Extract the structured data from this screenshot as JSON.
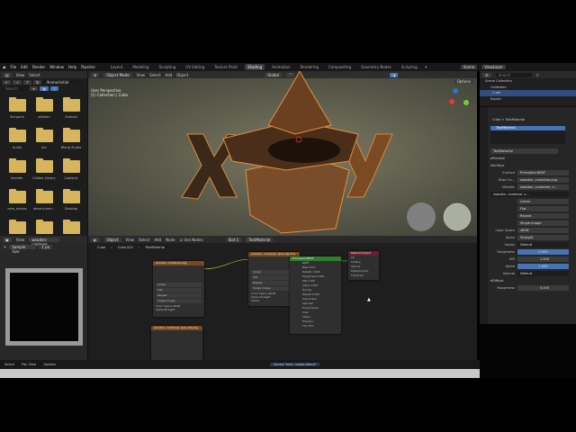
{
  "menu": [
    "File",
    "Edit",
    "Render",
    "Window",
    "Help",
    "Pipeline"
  ],
  "workspaces": [
    "Layout",
    "Modeling",
    "Sculpting",
    "UV Editing",
    "Texture Paint",
    "Shading",
    "Animation",
    "Rendering",
    "Compositing",
    "Geometry Nodes",
    "Scripting"
  ],
  "active_workspace": "Shading",
  "scene": "Scene",
  "view_layer": "ViewLayer",
  "files": {
    "header": [
      "View",
      "Select"
    ],
    "path": "/home/initial",
    "search_placeholder": "Search",
    "items": [
      "3rd-party",
      "ableton",
      "Android",
      "Audio",
      "bin",
      "Bforig Studio",
      "blender",
      "Calibre Library",
      "Coatsink",
      "core_dumps",
      "decent-sam...",
      "Desktop",
      "",
      "",
      ""
    ]
  },
  "viewport": {
    "mode": "Object Mode",
    "menus": [
      "View",
      "Select",
      "Add",
      "Object"
    ],
    "overlay1": "User Perspective",
    "overlay2": "(1) Collection | Cube",
    "transform": "Global",
    "options": "Options"
  },
  "outliner": {
    "search_placeholder": "Search",
    "items": [
      "Scene Collection",
      "Collection",
      "Cube",
      "Export"
    ]
  },
  "props": {
    "breadcrumb_obj": "Cube",
    "breadcrumb_mat": "TestMaterial",
    "slot": "TestMaterial",
    "material": "TestMaterial",
    "preview": "Preview",
    "surface_section": "Surface",
    "surface_label": "Surface",
    "surface_value": "Principled BSDF",
    "basecolor_label": "Base Co...",
    "basecolor_value": "wooden- container.png",
    "metallic_label": "Metallic",
    "metallic_value": "wooden- container- s...",
    "image": "wooden- containe- s...",
    "interp": "Linear",
    "proj": "Flat",
    "ext": "Repeat",
    "source": "Single Image",
    "colorspace_label": "Color Space",
    "colorspace": "sRGB",
    "alpha_label": "Alpha",
    "alpha": "Straight",
    "vector_label": "Vector",
    "vector": "Default",
    "roughness_label": "Roughness",
    "roughness": "0.500",
    "ior_label": "IOR",
    "ior": "1.500",
    "alpha2_label": "Alpha",
    "alpha2": "1.000",
    "normal_label": "Normal",
    "normal": "Default",
    "diffuse": "Diffuse",
    "diffrough_label": "Roughness",
    "diffrough": "0.000"
  },
  "imgedit": {
    "view": "View",
    "image": "wooden- containe",
    "tool": "Sample Size",
    "size": "1 px"
  },
  "nodes": {
    "object": "Object",
    "menus": [
      "View",
      "Select",
      "Add",
      "Node"
    ],
    "use_nodes": "Use Nodes",
    "slot": "Slot 1",
    "material": "TestMaterial",
    "breadcrumb": [
      "Cube",
      "Cube.001",
      "TestMaterial"
    ],
    "tex1": "wooden- container.png",
    "tex2": "wooden- container- specular.png",
    "tex3": "wooden- container- specular.png",
    "bsdf": "Principled BSDF",
    "output": "Material Output",
    "tex_rows": [
      "Linear",
      "Flat",
      "Repeat",
      "Single Image",
      "Color Space  sRGB",
      "Alpha  Straight",
      "Vector"
    ],
    "out_rows": [
      "All",
      "Surface",
      "Volume",
      "Displacement",
      "Thickness"
    ],
    "bsdf_rows": [
      "BSDF",
      "Base Color",
      "Metallic 0.000",
      "Roughness 0.500",
      "IOR 1.500",
      "Alpha 1.000",
      "Normal",
      "Weight 0.000",
      "Subsurface",
      "Specular",
      "Transmission",
      "Coat",
      "Sheen",
      "Emission",
      "Thin Film"
    ]
  },
  "status": {
    "items": [
      "Select",
      "Pan View",
      "Options"
    ],
    "message": "Saved \"test- model.blend\""
  }
}
